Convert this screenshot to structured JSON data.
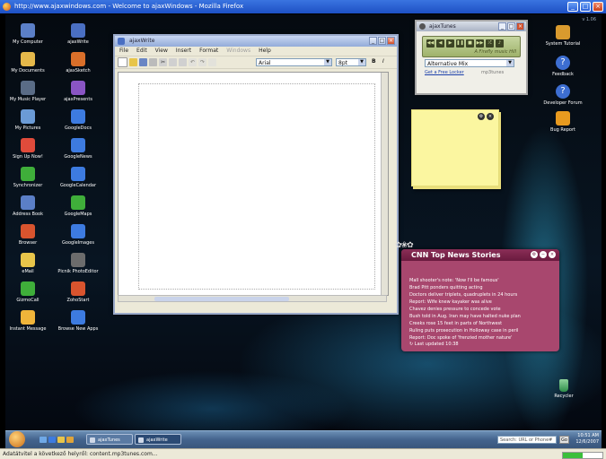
{
  "browser": {
    "title": "http://www.ajaxwindows.com - Welcome to ajaxWindows - Mozilla Firefox",
    "status_text": "Adatátvitel a következő helyről: content.mp3tunes.com...",
    "progress": 0.5
  },
  "desktop": {
    "version": "v 1.06",
    "left_icons": [
      {
        "label": "My Computer",
        "icon": "computer-icon",
        "color": "#5b7fc7"
      },
      {
        "label": "ajaxWrite",
        "icon": "ajaxwrite-icon",
        "color": "#4a6fc2"
      },
      {
        "label": "My Documents",
        "icon": "folder-icon",
        "color": "#e5b84a"
      },
      {
        "label": "ajaxSketch",
        "icon": "ajaxsketch-icon",
        "color": "#d96f2a"
      },
      {
        "label": "My Music Player",
        "icon": "headphones-icon",
        "color": "#5a6c86"
      },
      {
        "label": "ajaxPresents",
        "icon": "ajaxpresents-icon",
        "color": "#8a55c4"
      },
      {
        "label": "My Pictures",
        "icon": "pictures-icon",
        "color": "#6b9bd6"
      },
      {
        "label": "GoogleDocs",
        "icon": "googledocs-icon",
        "color": "#3d7be0"
      },
      {
        "label": "Sign Up Now!",
        "icon": "signup-icon",
        "color": "#e04b3b"
      },
      {
        "label": "GoogleNews",
        "icon": "googlenews-icon",
        "color": "#3d7be0"
      },
      {
        "label": "Synchronizer",
        "icon": "sync-icon",
        "color": "#3fae3a"
      },
      {
        "label": "GoogleCalendar",
        "icon": "googlecalendar-icon",
        "color": "#3d7be0"
      },
      {
        "label": "Address Book",
        "icon": "addressbook-icon",
        "color": "#5b7fc7"
      },
      {
        "label": "GoogleMaps",
        "icon": "googlemaps-icon",
        "color": "#3fae3a"
      },
      {
        "label": "Browser",
        "icon": "browser-icon",
        "color": "#d9542e"
      },
      {
        "label": "GoogleImages",
        "icon": "googleimages-icon",
        "color": "#3d7be0"
      },
      {
        "label": "eMail",
        "icon": "email-icon",
        "color": "#e8c54a"
      },
      {
        "label": "Picnik PhotoEditor",
        "icon": "picnik-icon",
        "color": "#6c6c6c"
      },
      {
        "label": "GizmoCall",
        "icon": "gizmo-icon",
        "color": "#3fae3a"
      },
      {
        "label": "ZohoStart",
        "icon": "zoho-icon",
        "color": "#d9542e"
      },
      {
        "label": "Instant Message",
        "icon": "im-icon",
        "color": "#f0b43a"
      },
      {
        "label": "Browse New Apps",
        "icon": "plus-icon",
        "color": "#3d7be0"
      }
    ],
    "right_icons": [
      {
        "label": "System Tutorial",
        "icon": "tutorial-icon",
        "color": "#d99a2e"
      },
      {
        "label": "Feedback",
        "icon": "help-icon",
        "color": "#3d6ed1"
      },
      {
        "label": "Developer Forum",
        "icon": "help-icon",
        "color": "#3d6ed1"
      },
      {
        "label": "Bug Report",
        "icon": "bug-icon",
        "color": "#e89a1f"
      }
    ],
    "recycler_label": "Recycler"
  },
  "ajaxwrite": {
    "title": "ajaxWrite",
    "menu": [
      "File",
      "Edit",
      "View",
      "Insert",
      "Format",
      "Windows",
      "Help"
    ],
    "disabled_menu": "Windows",
    "font": "Arial",
    "size": "8pt",
    "bold": "B",
    "italic": "I"
  },
  "ajaxtunes": {
    "title": "ajaxTunes",
    "brand": "A  Firefly music  Hill",
    "playlist": "Alternative Mix",
    "locker_link": "Get a Free Locker",
    "logo": "mp3tunes"
  },
  "news": {
    "title": "CNN Top News Stories",
    "items": [
      "Mall shooter's note: 'Now I'll be famous'",
      "Brad Pitt ponders quitting acting",
      "Doctors deliver triplets, quadruplets in 24 hours",
      "Report: Wife knew kayaker was alive",
      "Chavez denies pressure to concede vote",
      "Bush told in Aug. Iran may have halted nuke plan",
      "Creeks rose 15 feet in parts of Northwest",
      "Ruling puts prosecution in Holloway case in peril",
      "Report: Doc spoke of 'frenzied mother nature'"
    ],
    "footer": "Last updated 10:38"
  },
  "taskbar": {
    "tasks": [
      {
        "label": "ajaxTunes",
        "active": false
      },
      {
        "label": "ajaxWrite",
        "active": true
      }
    ],
    "search_placeholder": "Search: URL or Phone#",
    "go_label": "Go",
    "time": "10:51 AM",
    "date": "12/6/2007"
  },
  "colors": {
    "news_bg": "#a8476e",
    "sticky_bg": "#fbf6a0",
    "titlebar": "#1d50c4"
  }
}
